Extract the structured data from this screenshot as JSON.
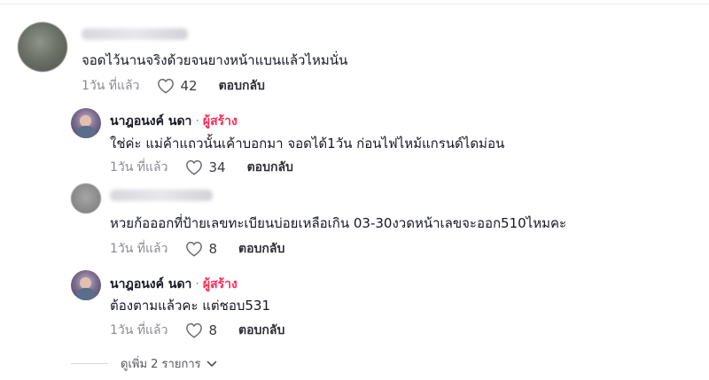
{
  "comments": [
    {
      "author": "",
      "text": "จอดไว้นานจริงด้วยจนยางหน้าแบนแล้วไหมนั่น",
      "time": "1วัน ที่แล้ว",
      "likes": "42",
      "reply_label": "ตอบกลับ"
    },
    {
      "author": "นาฎอนงค์ นดา",
      "separator": "·",
      "badge": "ผู้สร้าง",
      "text": "ใช่ค่ะ แม่ค้าแถวนั้นเค้าบอกมา จอดได้1วัน ก่อนไฟไหม้แกรนด์ไดม่อน",
      "time": "1วัน ที่แล้ว",
      "likes": "34",
      "reply_label": "ตอบกลับ"
    },
    {
      "author": "",
      "text": "หวยก้อออกที่ป้ายเลขทะเบียนบ่อยเหลือเกิน 03-30งวดหน้าเลขจะออก510ไหมคะ",
      "time": "1วัน ที่แล้ว",
      "likes": "8",
      "reply_label": "ตอบกลับ"
    },
    {
      "author": "นาฎอนงค์ นดา",
      "separator": "·",
      "badge": "ผู้สร้าง",
      "text": "ต้องตามแล้วคะ แต่ชอบ531",
      "time": "1วัน ที่แล้ว",
      "likes": "8",
      "reply_label": "ตอบกลับ"
    }
  ],
  "view_more": {
    "label": "ดูเพิ่ม 2 รายการ"
  },
  "icons": {
    "like": "heart-outline-icon",
    "expand": "chevron-down-icon"
  },
  "colors": {
    "creator_badge": "#fe2c55",
    "meta_text": "#8a8b91"
  }
}
